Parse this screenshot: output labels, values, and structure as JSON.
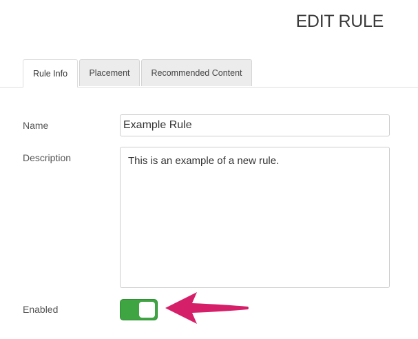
{
  "header": {
    "title": "EDIT RULE"
  },
  "tabs": [
    {
      "label": "Rule Info",
      "active": true
    },
    {
      "label": "Placement",
      "active": false
    },
    {
      "label": "Recommended Content",
      "active": false
    }
  ],
  "form": {
    "name_label": "Name",
    "name_value": "Example Rule",
    "description_label": "Description",
    "description_value": "This is an example of a new rule.",
    "enabled_label": "Enabled",
    "enabled": true
  },
  "colors": {
    "toggle_on": "#3ea542",
    "annotation_arrow": "#d61f69"
  }
}
